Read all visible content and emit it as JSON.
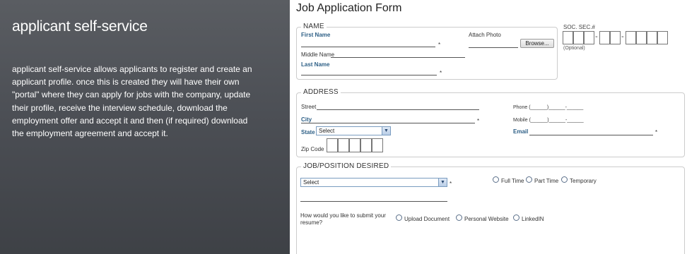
{
  "left_panel": {
    "heading": "applicant self-service",
    "description": "applicant self-service allows applicants to register and create an applicant profile.  once this is created they will have their own \"portal\" where they can apply for jobs with the company, update their profile, receive the interview schedule, download the employment offer and accept it and then (if required) download the employment agreement and accept it."
  },
  "form": {
    "title": "Job Application Form",
    "name_section": {
      "legend": "NAME",
      "first_name": "First Name",
      "middle_name": "Middle Name",
      "last_name": "Last Name",
      "attach_photo": "Attach Photo",
      "browse": "Browse...",
      "required_mark": "*"
    },
    "ssn": {
      "label": "SOC. SEC.#",
      "note": "(Optional)"
    },
    "address_section": {
      "legend": "ADDRESS",
      "street": "Street",
      "city": "City",
      "state": "State",
      "state_value": "Select",
      "zip": "Zip Code",
      "phone": "Phone",
      "mobile": "Mobile",
      "email": "Email",
      "phone_template": "(______)______-______"
    },
    "job_section": {
      "legend": "JOB/POSITION DESIRED",
      "job_select_value": "Select",
      "types": [
        "Full Time",
        "Part Time",
        "Temporary"
      ],
      "resume_question": "How would you like to submit your resume?",
      "resume_options": [
        "Upload Document",
        "Personal Website",
        "LinkedIN"
      ]
    }
  }
}
